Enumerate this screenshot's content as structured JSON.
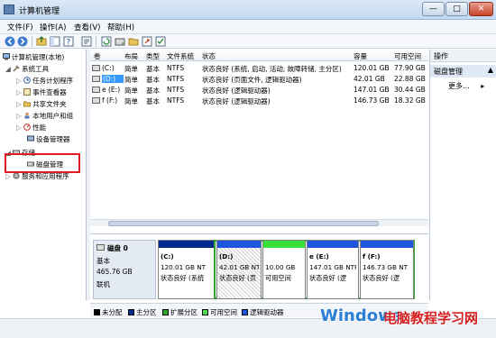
{
  "window": {
    "title": "计算机管理",
    "minimize": "—",
    "maximize": "□",
    "close": "✕"
  },
  "menu": [
    "文件(F)",
    "操作(A)",
    "查看(V)",
    "帮助(H)"
  ],
  "toolbar_icons": [
    "back-icon",
    "forward-icon",
    "up-folder-icon",
    "show-hide-tree-icon",
    "help-icon",
    "properties-icon",
    "refresh-icon",
    "disk-icon",
    "export-icon",
    "help2-icon"
  ],
  "tree": {
    "root": "计算机管理(本地)",
    "system_tools": "系统工具",
    "task_scheduler": "任务计划程序",
    "event_viewer": "事件查看器",
    "shared_folders": "共享文件夹",
    "local_users": "本地用户和组",
    "performance": "性能",
    "device_manager": "设备管理器",
    "storage": "存储",
    "disk_management": "磁盘管理",
    "services": "服务和应用程序"
  },
  "volume_table": {
    "headers": [
      "卷",
      "布局",
      "类型",
      "文件系统",
      "状态",
      "容量",
      "可用空间"
    ],
    "rows": [
      [
        "(C:)",
        "简单",
        "基本",
        "NTFS",
        "状态良好 (系统, 启动, 活动, 故障转储, 主分区)",
        "120.01 GB",
        "77.90 GB"
      ],
      [
        "(D:)",
        "简单",
        "基本",
        "NTFS",
        "状态良好 (页面文件, 逻辑驱动器)",
        "42.01 GB",
        "22.88 GB"
      ],
      [
        "e (E:)",
        "简单",
        "基本",
        "NTFS",
        "状态良好 (逻辑驱动器)",
        "147.01 GB",
        "30.44 GB"
      ],
      [
        "f (F:)",
        "简单",
        "基本",
        "NTFS",
        "状态良好 (逻辑驱动器)",
        "146.73 GB",
        "18.32 GB"
      ]
    ]
  },
  "disk": {
    "name": "磁盘 0",
    "type": "基本",
    "size": "465.76 GB",
    "status": "联机",
    "partitions": [
      {
        "label": "(C:)",
        "size": "120.01 GB NT",
        "status": "状态良好 (系统"
      },
      {
        "label": "(D:)",
        "size": "42.01 GB NT",
        "status": "状态良好 (页"
      },
      {
        "label": "",
        "size": "10.00 GB",
        "status": "可用空间"
      },
      {
        "label": "e  (E:)",
        "size": "147.01 GB NTF",
        "status": "状态良好 (逻"
      },
      {
        "label": "f  (F:)",
        "size": "146.73 GB NT",
        "status": "状态良好 (逻"
      }
    ]
  },
  "legend": [
    {
      "label": "未分配",
      "color": "#000000"
    },
    {
      "label": "主分区",
      "color": "#002a8f"
    },
    {
      "label": "扩展分区",
      "color": "#2fa42f"
    },
    {
      "label": "可用空间",
      "color": "#4ed94e"
    },
    {
      "label": "逻辑驱动器",
      "color": "#1f55e0"
    }
  ],
  "actions": {
    "header": "操作",
    "group": "磁盘管理",
    "more": "更多..."
  },
  "watermark": {
    "text": "Windows",
    "text2": "电脑教程学习网"
  },
  "colors": {
    "primary_bar": "#002a8f",
    "logical_bar": "#1f55e0",
    "free_bar": "#38e038",
    "extended_border": "#2fa42f"
  }
}
